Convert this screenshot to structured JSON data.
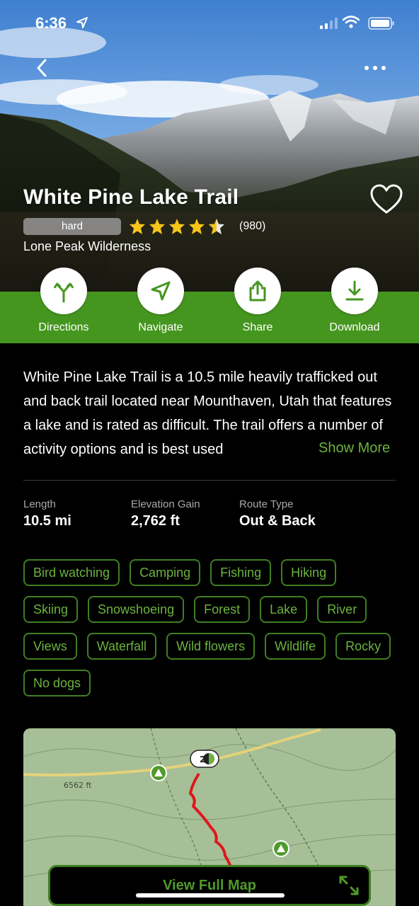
{
  "status_bar": {
    "time": "6:36"
  },
  "trail": {
    "name": "White Pine Lake Trail",
    "difficulty": "hard",
    "rating": 4.5,
    "reviews": "(980)",
    "location": "Lone Peak Wilderness"
  },
  "actions": [
    {
      "label": "Directions",
      "icon": "directions-icon"
    },
    {
      "label": "Navigate",
      "icon": "navigate-icon"
    },
    {
      "label": "Share",
      "icon": "share-icon"
    },
    {
      "label": "Download",
      "icon": "download-icon"
    }
  ],
  "description": {
    "text": "White Pine Lake Trail is a 10.5 mile heavily trafficked out and back trail located near Mounthaven, Utah that features a lake and is rated as difficult. The trail offers a number of activity options and is best used",
    "show_more": "Show More"
  },
  "stats": [
    {
      "label": "Length",
      "value": "10.5 mi"
    },
    {
      "label": "Elevation Gain",
      "value": "2,762 ft"
    },
    {
      "label": "Route Type",
      "value": "Out & Back"
    }
  ],
  "tags": [
    "Bird watching",
    "Camping",
    "Fishing",
    "Hiking",
    "Skiing",
    "Snowshoeing",
    "Forest",
    "Lake",
    "River",
    "Views",
    "Waterfall",
    "Wild flowers",
    "Wildlife",
    "Rocky",
    "No dogs"
  ],
  "map": {
    "elevation_label": "6562 ft",
    "marker_label": "2",
    "view_full_map": "View Full Map"
  },
  "colors": {
    "accent": "#45961f",
    "tag_text": "#6cb33f",
    "tag_border": "#3f7f22",
    "route": "#e0161b",
    "star": "#f5c518"
  }
}
